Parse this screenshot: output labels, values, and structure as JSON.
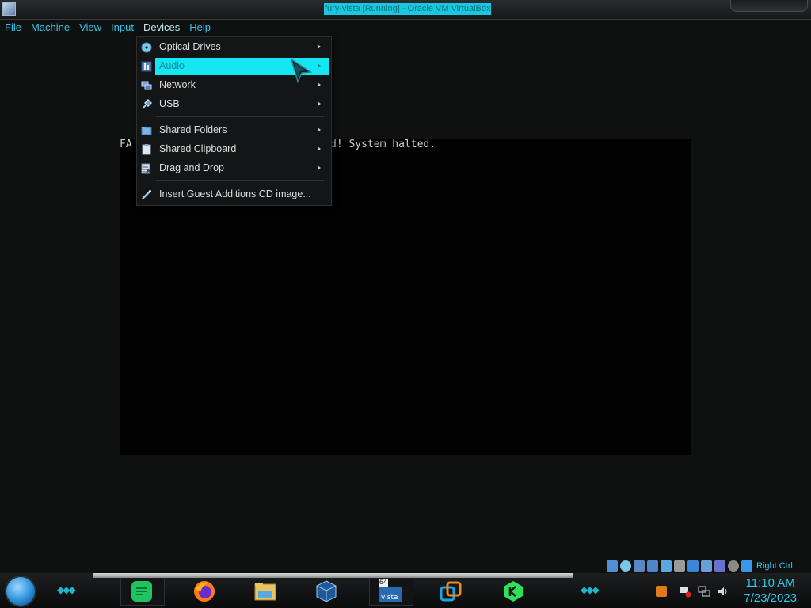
{
  "window": {
    "title": "fury-vista [Running] - Oracle VM VirtualBox"
  },
  "menubar": {
    "items": [
      "File",
      "Machine",
      "View",
      "Input",
      "Devices",
      "Help"
    ],
    "active": "Devices"
  },
  "vm_screen": {
    "text_left": "FA",
    "text_right": "d! System halted."
  },
  "devices_menu": {
    "items": [
      {
        "label": "Optical Drives",
        "icon": "optical-disc-icon",
        "submenu": true
      },
      {
        "label": "Audio",
        "icon": "audio-icon",
        "submenu": true,
        "highlighted": true
      },
      {
        "label": "Network",
        "icon": "network-icon",
        "submenu": true
      },
      {
        "label": "USB",
        "icon": "usb-icon",
        "submenu": true
      },
      {
        "label": "Shared Folders",
        "icon": "shared-folder-icon",
        "submenu": true
      },
      {
        "label": "Shared Clipboard",
        "icon": "clipboard-icon",
        "submenu": true
      },
      {
        "label": "Drag and Drop",
        "icon": "drag-drop-icon",
        "submenu": true
      },
      {
        "label": "Insert Guest Additions CD image...",
        "icon": "guest-additions-icon",
        "submenu": false
      }
    ]
  },
  "statusbar": {
    "host_key": "Right Ctrl"
  },
  "taskbar": {
    "apps": [
      "chat-app-icon",
      "firefox-icon",
      "file-explorer-icon",
      "virtualbox-icon",
      "vista-vm-icon",
      "vmware-icon",
      "kick-icon"
    ],
    "vista_badge_top": "64",
    "vista_badge_bottom": "vista",
    "clock_time": "11:10 AM",
    "clock_date": "7/23/2023"
  },
  "colors": {
    "accent": "#2ec8e8",
    "highlight": "#14e6f2",
    "background": "#0f1010"
  }
}
